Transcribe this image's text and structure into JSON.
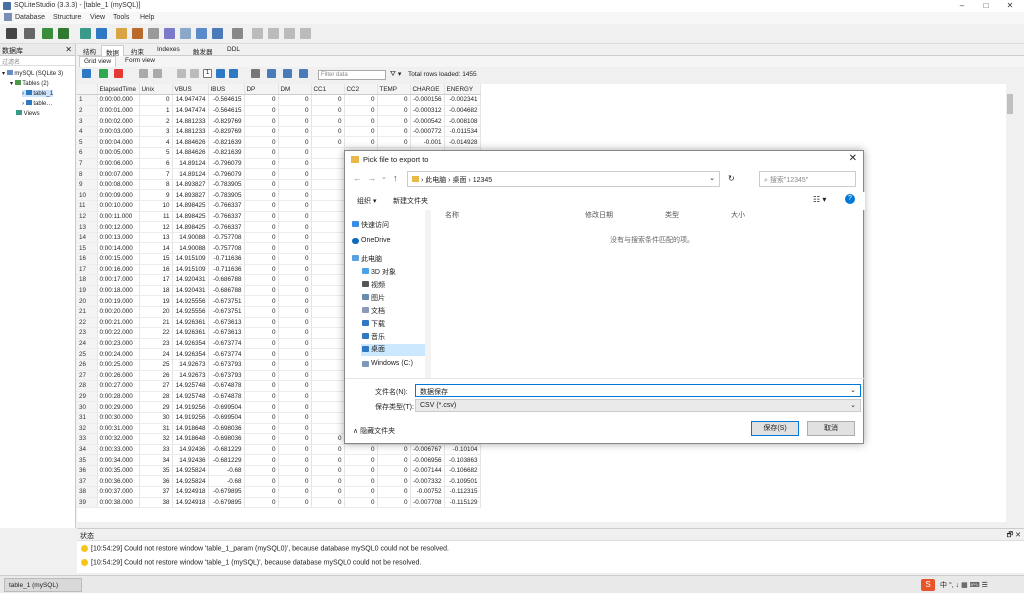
{
  "window": {
    "title": "SQLiteStudio (3.3.3) - [table_1 (mySQL)]",
    "min": "–",
    "max": "□",
    "close": "✕"
  },
  "menu": [
    "Database",
    "Structure",
    "View",
    "Tools",
    "Help"
  ],
  "left_panel": {
    "title": "数据库",
    "filter_placeholder": "过滤名",
    "tree": {
      "db": "mySQL (SQLite 3)",
      "tables": "Tables (2)",
      "t1": "table_1",
      "t2": "table…",
      "views": "Views"
    }
  },
  "tabs": [
    "结构",
    "数据",
    "约束",
    "Indexes",
    "触发器",
    "DDL"
  ],
  "subtabs": [
    "Grid view",
    "Form view"
  ],
  "gridbar": {
    "filter_placeholder": "Filter data",
    "rows_loaded": "Total rows loaded: 1455"
  },
  "grid": {
    "columns": [
      "ElapsedTime",
      "Unix",
      "VBUS",
      "IBUS",
      "DP",
      "DM",
      "CC1",
      "CC2",
      "TEMP",
      "CHARGE",
      "ENERGY"
    ],
    "rows": [
      [
        "0:00:00.000",
        "0",
        "14.947474",
        "-0.564615",
        "0",
        "0",
        "0",
        "0",
        "0",
        "-0.000156",
        "-0.002341"
      ],
      [
        "0:00:01.000",
        "1",
        "14.947474",
        "-0.564615",
        "0",
        "0",
        "0",
        "0",
        "0",
        "-0.000312",
        "-0.004682"
      ],
      [
        "0:00:02.000",
        "2",
        "14.881233",
        "-0.829769",
        "0",
        "0",
        "0",
        "0",
        "0",
        "-0.000542",
        "-0.008108"
      ],
      [
        "0:00:03.000",
        "3",
        "14.881233",
        "-0.829769",
        "0",
        "0",
        "0",
        "0",
        "0",
        "-0.000772",
        "-0.011534"
      ],
      [
        "0:00:04.000",
        "4",
        "14.884626",
        "-0.821639",
        "0",
        "0",
        "0",
        "0",
        "0",
        "-0.001",
        "-0.014928"
      ],
      [
        "0:00:05.000",
        "5",
        "14.884626",
        "-0.821639",
        "0",
        "0",
        "",
        "",
        "",
        "",
        ""
      ],
      [
        "0:00:06.000",
        "6",
        "14.89124",
        "-0.796079",
        "0",
        "0",
        "",
        "",
        "",
        "",
        ""
      ],
      [
        "0:00:07.000",
        "7",
        "14.89124",
        "-0.796079",
        "0",
        "0",
        "",
        "",
        "",
        "",
        ""
      ],
      [
        "0:00:08.000",
        "8",
        "14.893827",
        "-0.783905",
        "0",
        "0",
        "",
        "",
        "",
        "",
        ""
      ],
      [
        "0:00:09.000",
        "9",
        "14.893827",
        "-0.783905",
        "0",
        "0",
        "",
        "",
        "",
        "",
        ""
      ],
      [
        "0:00:10.000",
        "10",
        "14.898425",
        "-0.766337",
        "0",
        "0",
        "",
        "",
        "",
        "",
        ""
      ],
      [
        "0:00:11.000",
        "11",
        "14.898425",
        "-0.766337",
        "0",
        "0",
        "",
        "",
        "",
        "",
        ""
      ],
      [
        "0:00:12.000",
        "12",
        "14.898425",
        "-0.766337",
        "0",
        "0",
        "",
        "",
        "",
        "",
        ""
      ],
      [
        "0:00:13.000",
        "13",
        "14.90088",
        "-0.757708",
        "0",
        "0",
        "",
        "",
        "",
        "",
        ""
      ],
      [
        "0:00:14.000",
        "14",
        "14.90088",
        "-0.757708",
        "0",
        "0",
        "",
        "",
        "",
        "",
        ""
      ],
      [
        "0:00:15.000",
        "15",
        "14.915109",
        "-0.711636",
        "0",
        "0",
        "",
        "",
        "",
        "",
        ""
      ],
      [
        "0:00:16.000",
        "16",
        "14.915109",
        "-0.711636",
        "0",
        "0",
        "",
        "",
        "",
        "",
        ""
      ],
      [
        "0:00:17.000",
        "17",
        "14.920431",
        "-0.686788",
        "0",
        "0",
        "",
        "",
        "",
        "",
        ""
      ],
      [
        "0:00:18.000",
        "18",
        "14.920431",
        "-0.686788",
        "0",
        "0",
        "",
        "",
        "",
        "",
        ""
      ],
      [
        "0:00:19.000",
        "19",
        "14.925556",
        "-0.673751",
        "0",
        "0",
        "",
        "",
        "",
        "",
        ""
      ],
      [
        "0:00:20.000",
        "20",
        "14.925556",
        "-0.673751",
        "0",
        "0",
        "",
        "",
        "",
        "",
        ""
      ],
      [
        "0:00:21.000",
        "21",
        "14.926361",
        "-0.673613",
        "0",
        "0",
        "",
        "",
        "",
        "",
        ""
      ],
      [
        "0:00:22.000",
        "22",
        "14.926361",
        "-0.673613",
        "0",
        "0",
        "",
        "",
        "",
        "",
        ""
      ],
      [
        "0:00:23.000",
        "23",
        "14.926354",
        "-0.673774",
        "0",
        "0",
        "",
        "",
        "",
        "",
        ""
      ],
      [
        "0:00:24.000",
        "24",
        "14.926354",
        "-0.673774",
        "0",
        "0",
        "",
        "",
        "",
        "",
        ""
      ],
      [
        "0:00:25.000",
        "25",
        "14.92673",
        "-0.673793",
        "0",
        "0",
        "",
        "",
        "",
        "",
        ""
      ],
      [
        "0:00:26.000",
        "26",
        "14.92673",
        "-0.673793",
        "0",
        "0",
        "",
        "",
        "",
        "",
        ""
      ],
      [
        "0:00:27.000",
        "27",
        "14.925748",
        "-0.674878",
        "0",
        "0",
        "",
        "",
        "",
        "",
        ""
      ],
      [
        "0:00:28.000",
        "28",
        "14.925748",
        "-0.674878",
        "0",
        "0",
        "",
        "",
        "",
        "",
        ""
      ],
      [
        "0:00:29.000",
        "29",
        "14.919256",
        "-0.699504",
        "0",
        "0",
        "",
        "",
        "",
        "",
        ""
      ],
      [
        "0:00:30.000",
        "30",
        "14.919256",
        "-0.699504",
        "0",
        "0",
        "",
        "",
        "",
        "",
        ""
      ],
      [
        "0:00:31.000",
        "31",
        "14.918648",
        "-0.698036",
        "0",
        "0",
        "",
        "",
        "",
        "",
        ""
      ],
      [
        "0:00:32.000",
        "32",
        "14.918648",
        "-0.698036",
        "0",
        "0",
        "0",
        "0",
        "0",
        "-0.006578",
        "-0.098217"
      ],
      [
        "0:00:33.000",
        "33",
        "14.92436",
        "-0.681229",
        "0",
        "0",
        "0",
        "0",
        "0",
        "-0.006767",
        "-0.10104"
      ],
      [
        "0:00:34.000",
        "34",
        "14.92436",
        "-0.681229",
        "0",
        "0",
        "0",
        "0",
        "0",
        "-0.006956",
        "-0.103863"
      ],
      [
        "0:00:35.000",
        "35",
        "14.925824",
        "-0.68",
        "0",
        "0",
        "0",
        "0",
        "0",
        "-0.007144",
        "-0.106682"
      ],
      [
        "0:00:36.000",
        "36",
        "14.925824",
        "-0.68",
        "0",
        "0",
        "0",
        "0",
        "0",
        "-0.007332",
        "-0.109501"
      ],
      [
        "0:00:37.000",
        "37",
        "14.924918",
        "-0.679895",
        "0",
        "0",
        "0",
        "0",
        "0",
        "-0.00752",
        "-0.112315"
      ],
      [
        "0:00:38.000",
        "38",
        "14.924918",
        "-0.679895",
        "0",
        "0",
        "0",
        "0",
        "0",
        "-0.007708",
        "-0.115129"
      ]
    ]
  },
  "status": {
    "title": "状态",
    "messages": [
      "[10:54:29] Could not restore window 'table_1_param (mySQL0)', because database mySQL0 could not be resolved.",
      "[10:54:29] Could not restore window 'table_1 (mySQL)', because database mySQL0 could not be resolved."
    ]
  },
  "taskbar": {
    "item": "table_1 (mySQL)",
    "ime": "中 °, ↓ ▦ ⌨ ☰"
  },
  "dialog": {
    "title": "Pick file to export to",
    "path": [
      "此电脑",
      "桌面",
      "12345"
    ],
    "search_placeholder": "搜索\"12345\"",
    "organize": "组织 ▾",
    "new_folder": "新建文件夹",
    "nav": [
      "快速访问",
      "OneDrive",
      "此电脑",
      "3D 对象",
      "视频",
      "图片",
      "文档",
      "下载",
      "音乐",
      "桌面",
      "Windows (C:)"
    ],
    "columns": [
      "名称",
      "修改日期",
      "类型",
      "大小"
    ],
    "empty": "没有与搜索条件匹配的项。",
    "filename_label": "文件名(N):",
    "filename": "数据保存",
    "filetype_label": "保存类型(T):",
    "filetype": "CSV (*.csv)",
    "hide_folders": "隐藏文件夹",
    "save": "保存(S)",
    "cancel": "取消"
  },
  "colors": {
    "accent": "#0078d7",
    "selected_nav": "#cce8ff"
  }
}
